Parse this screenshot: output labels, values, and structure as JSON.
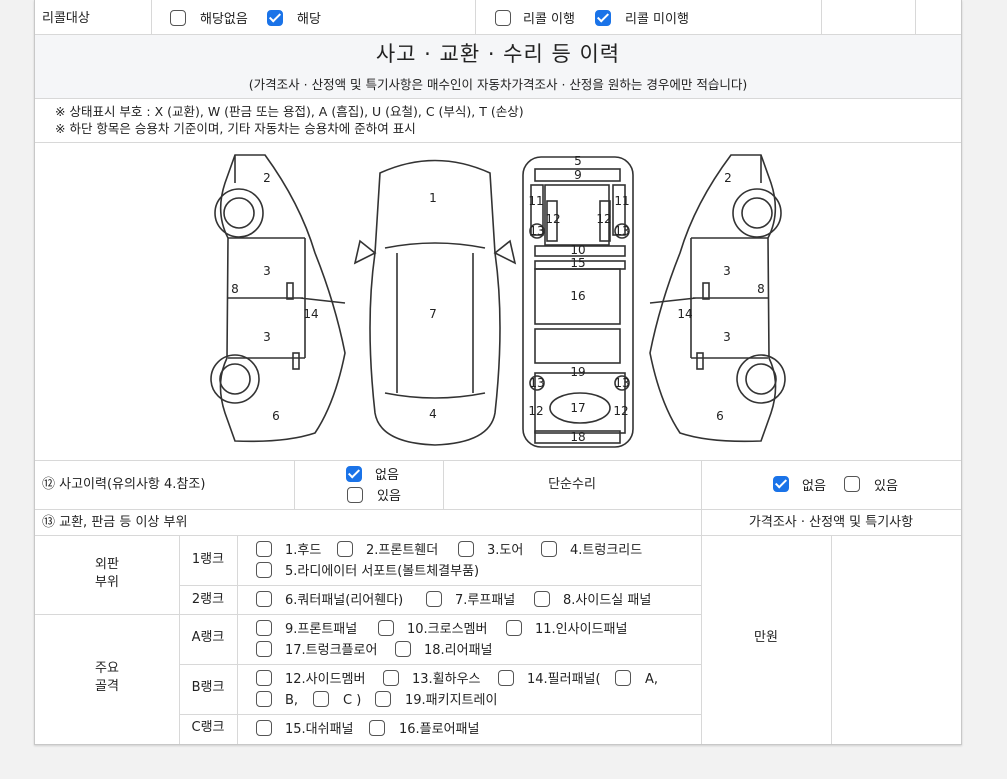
{
  "recall": {
    "label": "리콜대상",
    "opt1": "해당없음",
    "opt2": "해당",
    "opt3": "리콜 이행",
    "opt4": "리콜 미이행"
  },
  "history": {
    "title": "사고 · 교환 · 수리 등 이력",
    "subtitle": "(가격조사 · 산정액 및 특기사항은 매수인이 자동차가격조사 · 산정을 원하는 경우에만 적습니다)",
    "note1": "※ 상태표시 부호 : X (교환), W (판금 또는 용접), A (흠집), U (요철), C (부식), T (손상)",
    "note2": "※ 하단 항목은 승용차 기준이며, 기타 자동차는 승용차에 준하여 표시"
  },
  "diagram": {
    "nums": [
      "1",
      "2",
      "3",
      "4",
      "5",
      "6",
      "7",
      "8",
      "9",
      "10",
      "11",
      "12",
      "13",
      "14",
      "15",
      "16",
      "17",
      "18",
      "19"
    ]
  },
  "accident": {
    "label": "⑫ 사고이력(유의사항 4.참조)",
    "none": "없음",
    "exists": "있음",
    "simple_repair": "단순수리",
    "none2": "없음",
    "exists2": "있음"
  },
  "parts": {
    "label": "⑬ 교환, 판금 등 이상 부위",
    "price_header": "가격조사 · 산정액 및 특기사항",
    "unit": "만원",
    "outer": "외판\n부위",
    "outer1": "외판",
    "outer2": "부위",
    "frame1": "주요",
    "frame2": "골격",
    "rank1": "1랭크",
    "rank2": "2랭크",
    "rankA": "A랭크",
    "rankB": "B랭크",
    "rankC": "C랭크",
    "p1": "1.후드",
    "p2": "2.프론트휀더",
    "p3": "3.도어",
    "p4": "4.트렁크리드",
    "p5": "5.라디에이터 서포트(볼트체결부품)",
    "p6": "6.쿼터패널(리어휀다)",
    "p7": "7.루프패널",
    "p8": "8.사이드실 패널",
    "p9": "9.프론트패널",
    "p10": "10.크로스멤버",
    "p11": "11.인사이드패널",
    "p17": "17.트렁크플로어",
    "p18": "18.리어패널",
    "p12": "12.사이드멤버",
    "p13": "13.휠하우스",
    "p14": "14.필러패널(",
    "p14a": "A,",
    "p14b": "B,",
    "p14c": "C )",
    "p19": "19.패키지트레이",
    "p15": "15.대쉬패널",
    "p16": "16.플로어패널"
  }
}
